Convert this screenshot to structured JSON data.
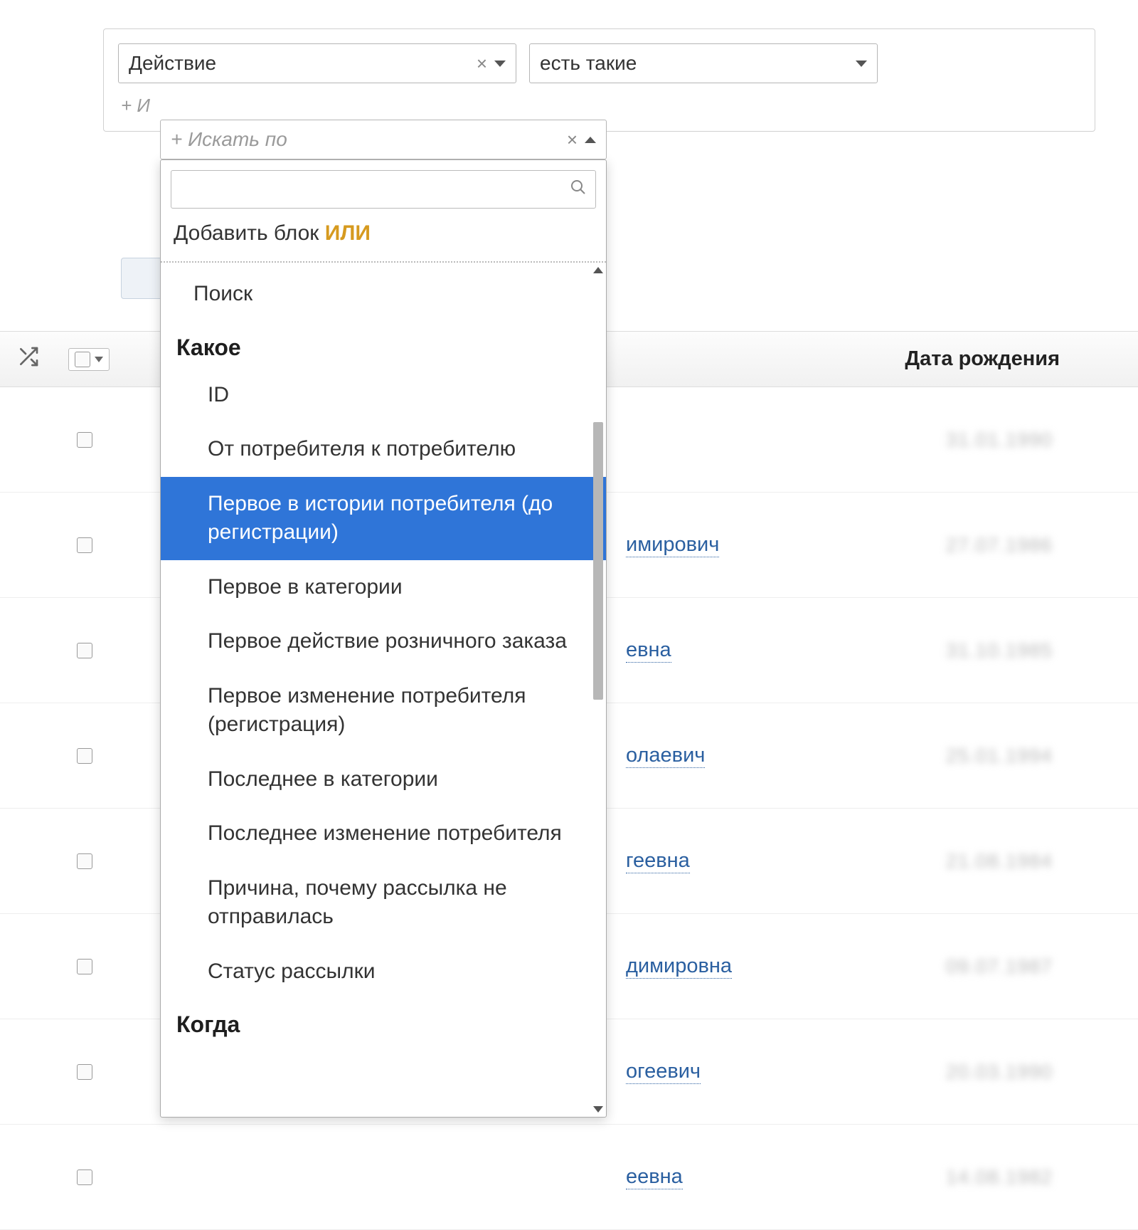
{
  "filter": {
    "action_value": "Действие",
    "condition_value": "есть такие",
    "search_by_placeholder": "+ Искать по",
    "add_search_hint": "+ И"
  },
  "dropdown": {
    "add_or_prefix": "Добавить блок ",
    "add_or_word": "ИЛИ",
    "items": [
      {
        "type": "item",
        "label": "Поиск",
        "cls": "search-item"
      },
      {
        "type": "group",
        "label": "Какое"
      },
      {
        "type": "item",
        "label": "ID"
      },
      {
        "type": "item",
        "label": "От потребителя к потребителю"
      },
      {
        "type": "item",
        "label": "Первое в истории потребителя (до регистрации)",
        "selected": true
      },
      {
        "type": "item",
        "label": "Первое в категории"
      },
      {
        "type": "item",
        "label": "Первое действие розничного заказа"
      },
      {
        "type": "item",
        "label": "Первое изменение потребителя (регистрация)"
      },
      {
        "type": "item",
        "label": "Последнее в категории"
      },
      {
        "type": "item",
        "label": "Последнее изменение потребителя"
      },
      {
        "type": "item",
        "label": "Причина, почему рассылка не отправилась"
      },
      {
        "type": "item",
        "label": "Статус рассылки"
      },
      {
        "type": "group",
        "label": "Когда"
      }
    ]
  },
  "table": {
    "dob_header": "Дата рождения",
    "rows": [
      {
        "name_fragment": "",
        "dob": "31.01.1990"
      },
      {
        "name_fragment": "имирович",
        "dob": "27.07.1986"
      },
      {
        "name_fragment": "евна",
        "dob": "31.10.1985"
      },
      {
        "name_fragment": "олаевич",
        "dob": "25.01.1994"
      },
      {
        "name_fragment": "геевна",
        "dob": "21.08.1984"
      },
      {
        "name_fragment": "димировна",
        "dob": "09.07.1987"
      },
      {
        "name_fragment": "огеевич",
        "dob": "20.03.1990"
      },
      {
        "name_fragment": "еевна",
        "dob": "14.08.1982"
      }
    ]
  }
}
